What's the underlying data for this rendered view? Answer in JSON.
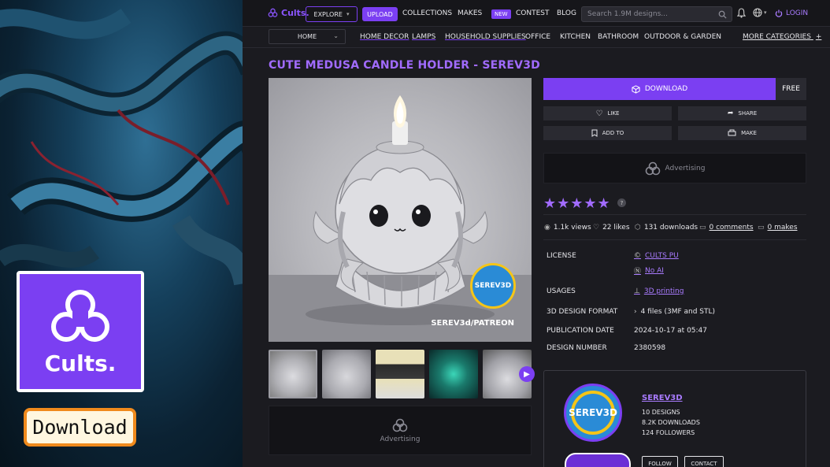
{
  "promo": {
    "logo_word": "Cults.",
    "download_label": "Download"
  },
  "topbar": {
    "brand": "Cults.",
    "explore": "EXPLORE",
    "upload": "UPLOAD",
    "collections": "COLLECTIONS",
    "makes": "MAKES",
    "new_badge": "NEW",
    "contest": "CONTEST",
    "blog": "BLOG",
    "search_placeholder": "Search 1.9M designs...",
    "login": "LOGIN"
  },
  "catbar": {
    "home": "HOME",
    "categories": [
      "HOME DECOR",
      "LAMPS",
      "HOUSEHOLD SUPPLIES",
      "OFFICE",
      "KITCHEN",
      "BATHROOM",
      "OUTDOOR & GARDEN"
    ],
    "more": "MORE CATEGORIES"
  },
  "product": {
    "title": "CUTE MEDUSA CANDLE HOLDER - SEREV3D",
    "watermark_logo": "SEREV3D",
    "watermark_text": "SEREV3d/PATREON"
  },
  "ads": {
    "label": "Advertising"
  },
  "actions": {
    "download": "DOWNLOAD",
    "price": "FREE",
    "like": "LIKE",
    "share": "SHARE",
    "add_to": "ADD TO",
    "make": "MAKE"
  },
  "rating": {
    "stars": "★★★★★",
    "help": "?"
  },
  "stats": {
    "views": "1.1k views",
    "likes": "22 likes",
    "downloads": "131 downloads",
    "comments": "0 comments",
    "makes": "0 makes"
  },
  "details": {
    "license_k": "LICENSE",
    "license_v1": "CULTS PU",
    "license_v2": "No AI",
    "usages_k": "USAGES",
    "usages_v": "3D printing",
    "format_k": "3D DESIGN FORMAT",
    "format_v": "4 files (3MF and STL)",
    "pub_k": "PUBLICATION DATE",
    "pub_v": "2024-10-17 at 05:47",
    "num_k": "DESIGN NUMBER",
    "num_v": "2380598"
  },
  "creator": {
    "avatar_text": "SEREV3D",
    "name": "SEREV3D",
    "designs": "10 DESIGNS",
    "downloads": "8.2K DOWNLOADS",
    "followers": "124 FOLLOWERS",
    "follow": "FOLLOW",
    "contact": "CONTACT"
  },
  "colors": {
    "accent": "#7b3ff2",
    "accent_text": "#a16bff",
    "background": "#1b1b20"
  }
}
